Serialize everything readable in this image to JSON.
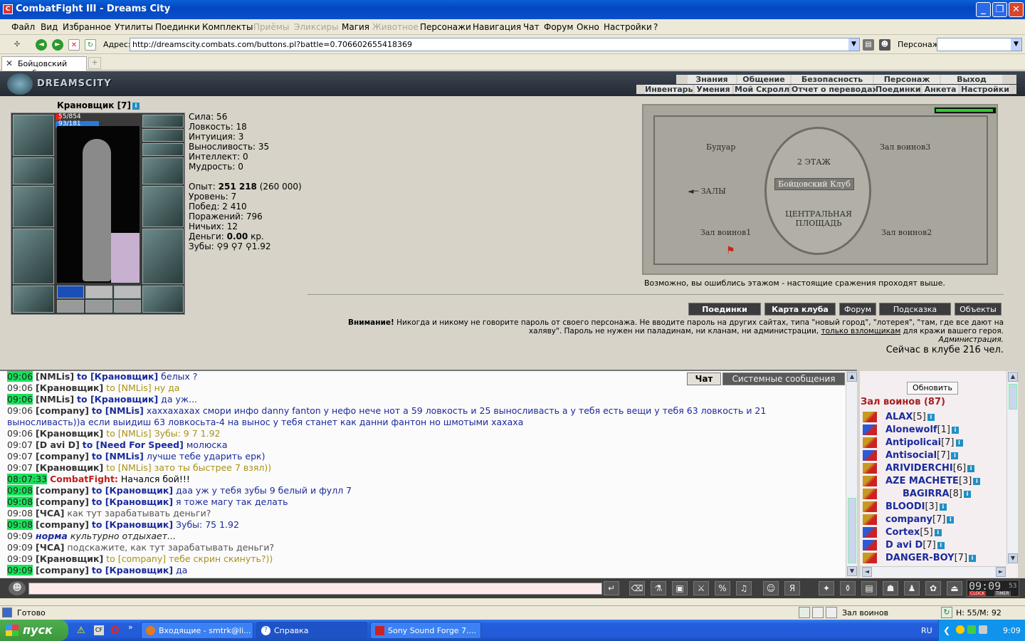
{
  "window": {
    "title": "CombatFight III - Dreams City"
  },
  "menu": {
    "items": [
      "Файл",
      "Вид",
      "Избранное",
      "Утилиты",
      "Поединки",
      "Комплекты",
      "Приёмы",
      "Эликсиры",
      "Магия",
      "Животное",
      "Персонажи",
      "Навигация",
      "Чат",
      "Форум",
      "Окно",
      "Настройки",
      "?"
    ]
  },
  "address": {
    "label": "Адрес:",
    "url": "http://dreamscity.combats.com/buttons.pl?battle=0.706602655418369",
    "char_label": "Персонаж:"
  },
  "tab": {
    "label": "Бойцовский клуб"
  },
  "site": {
    "logo": "DREAMSCITY",
    "nav_top": [
      "Знания",
      "Общение",
      "Безопасность",
      "Персонаж",
      "Выход"
    ],
    "nav_bottom": [
      "Инвентарь",
      "Умения",
      "Мой Скролл",
      "Отчет о переводах",
      "Поединки",
      "Анкета",
      "Настройки"
    ]
  },
  "character": {
    "name": "Крановщик [7]",
    "hp": "55/854",
    "mana": "93/181",
    "hp_fraction": 0.064,
    "mana_fraction": 0.514,
    "stats": [
      "Сила: 56",
      "Ловкость: 18",
      "Интуиция: 3",
      "Выносливость: 35",
      "Интеллект: 0",
      "Мудрость: 0"
    ],
    "exp_label": "Опыт: ",
    "exp_value": "251 218",
    "exp_next": " (260 000)",
    "level": "Уровень: 7",
    "wins": "Побед: 2 410",
    "losses": "Поражений: 796",
    "draws": "Ничьих: 12",
    "money_label": "Деньги: ",
    "money_value": "0.00",
    "money_unit": " кр.",
    "teeth": "Зубы: ⚲9 ⚲7 ⚲1.92"
  },
  "map": {
    "floor": "2 ЭТАЖ",
    "club": "Бойцовский Клуб",
    "boudoir": "Будуар",
    "hall3": "Зал воинов3",
    "halls": "◄─ ЗАЛЫ",
    "square": "ЦЕНТРАЛЬНАЯ ПЛОЩАДЬ",
    "hall1": "Зал воинов1",
    "hall2": "Зал воинов2",
    "caption": "Возможно, вы ошиблись этажом - настоящие сражения проходят выше."
  },
  "buttons": [
    "Поединки",
    "Карта клуба",
    "Форум",
    "Подсказка",
    "Объекты"
  ],
  "warning": {
    "bold": "Внимание!",
    "text1": " Никогда и никому не говорите пароль от своего персонажа. Не вводите пароль на других сайтах, типа \"новый город\", \"лотерея\", \"там, где все дают на",
    "text2": "халяву\". Пароль не нужен ни паладинам, ни кланам, ни администрации, ",
    "link": "только взломщикам",
    "text3": " для кражи вашего героя.",
    "admin": "Администрация.",
    "online": "Сейчас в клубе 216 чел."
  },
  "chat": {
    "tab_chat": "Чат",
    "tab_system": "Системные сообщения",
    "lines": [
      {
        "t": "09:06",
        "hl": true,
        "n": "NMLis",
        "to": "Крановщик",
        "priv": true,
        "m": "белых ?"
      },
      {
        "t": "09:06",
        "hl": false,
        "n": "Крановщик",
        "to": "NMLis",
        "priv": false,
        "m": "ну да"
      },
      {
        "t": "09:06",
        "hl": true,
        "n": "NMLis",
        "to": "Крановщик",
        "priv": true,
        "m": "да уж..."
      },
      {
        "t": "09:06",
        "hl": false,
        "n": "company",
        "to": "NMLis",
        "priv": true,
        "m": "хаххахахах смори инфо danny fanton у нефо нече нот а 59 ловкость и 25 выносливасть а у тебя есть вещи у тебя 63 ловкость и 21"
      },
      {
        "t": "",
        "hl": false,
        "n": "",
        "to": "",
        "priv": true,
        "m": "выносливасть))а если выидиш 63 ловкосьта-4 на вынос у тебя станет как данни фантон но шмотыми хахаха"
      },
      {
        "t": "09:06",
        "hl": false,
        "n": "Крановщик",
        "to": "NMLis",
        "priv": false,
        "m": "Зубы: 9 7 1.92"
      },
      {
        "t": "09:07",
        "hl": false,
        "n": "D avi D",
        "to": "Need For Speed",
        "priv": true,
        "m": "молюска"
      },
      {
        "t": "09:07",
        "hl": false,
        "n": "company",
        "to": "NMLis",
        "priv": true,
        "m": "лучше тебе ударить ерк)"
      },
      {
        "t": "09:07",
        "hl": false,
        "n": "Крановщик",
        "to": "NMLis",
        "priv": false,
        "m": "зато ты быстрее 7 взял))"
      },
      {
        "t": "08:07:33",
        "hl": true,
        "sys": true,
        "n": "CombatFight:",
        "m": "Начался бой!!!"
      },
      {
        "t": "09:08",
        "hl": true,
        "n": "company",
        "to": "Крановщик",
        "priv": true,
        "m": "даа уж у тебя зубы 9 белый и фулл 7"
      },
      {
        "t": "09:08",
        "hl": true,
        "n": "company",
        "to": "Крановщик",
        "priv": true,
        "m": "я тоже магу так делать"
      },
      {
        "t": "09:08",
        "hl": false,
        "n": "ЧСА",
        "to": "",
        "priv": false,
        "m": "как тут зарабатывать деньги?"
      },
      {
        "t": "09:08",
        "hl": true,
        "n": "company",
        "to": "Крановщик",
        "priv": true,
        "m": "Зубы: 75 1.92"
      },
      {
        "t": "09:09",
        "hl": false,
        "emote": true,
        "n": "норма",
        "m": "культурно отдыхает..."
      },
      {
        "t": "09:09",
        "hl": false,
        "n": "ЧСА",
        "to": "",
        "priv": false,
        "m": "подскажите, как тут зарабатывать деньги?"
      },
      {
        "t": "09:09",
        "hl": false,
        "n": "Крановщик",
        "to": "company",
        "priv": false,
        "m": "тебе скрин скинуть?))"
      },
      {
        "t": "09:09",
        "hl": true,
        "n": "company",
        "to": "Крановщик",
        "priv": true,
        "m": "да"
      }
    ]
  },
  "users": {
    "refresh": "Обновить",
    "room": "Зал воинов (87)",
    "list": [
      {
        "n": "ALAX",
        "l": "[5]"
      },
      {
        "n": "Alonewolf",
        "l": "[1]"
      },
      {
        "n": "Antipolicai",
        "l": "[7]"
      },
      {
        "n": "Antisocial",
        "l": "[7]"
      },
      {
        "n": "ARIVIDERCHI",
        "l": "[6]"
      },
      {
        "n": "AZE MACHETE",
        "l": "[3]"
      },
      {
        "n": "BAGIRRA",
        "l": "[8]"
      },
      {
        "n": "BLOODI",
        "l": "[3]"
      },
      {
        "n": "company",
        "l": "[7]"
      },
      {
        "n": "Cortex",
        "l": "[5]"
      },
      {
        "n": "D avi D",
        "l": "[7]"
      },
      {
        "n": "DANGER-BOY",
        "l": "[7]"
      }
    ]
  },
  "clock": {
    "time": "09:09",
    "sec": "53",
    "clock_label": "CLOCK",
    "timer_label": "TIMER"
  },
  "status": {
    "ready": "Готово",
    "zone": "Зал воинов",
    "hm": "H: 55/M: 92"
  },
  "taskbar": {
    "start": "пуск",
    "tasks": [
      "Входящие - smtrk@li...",
      "Справка",
      "Sony Sound Forge 7...."
    ],
    "lang": "RU",
    "time": "9:09"
  }
}
